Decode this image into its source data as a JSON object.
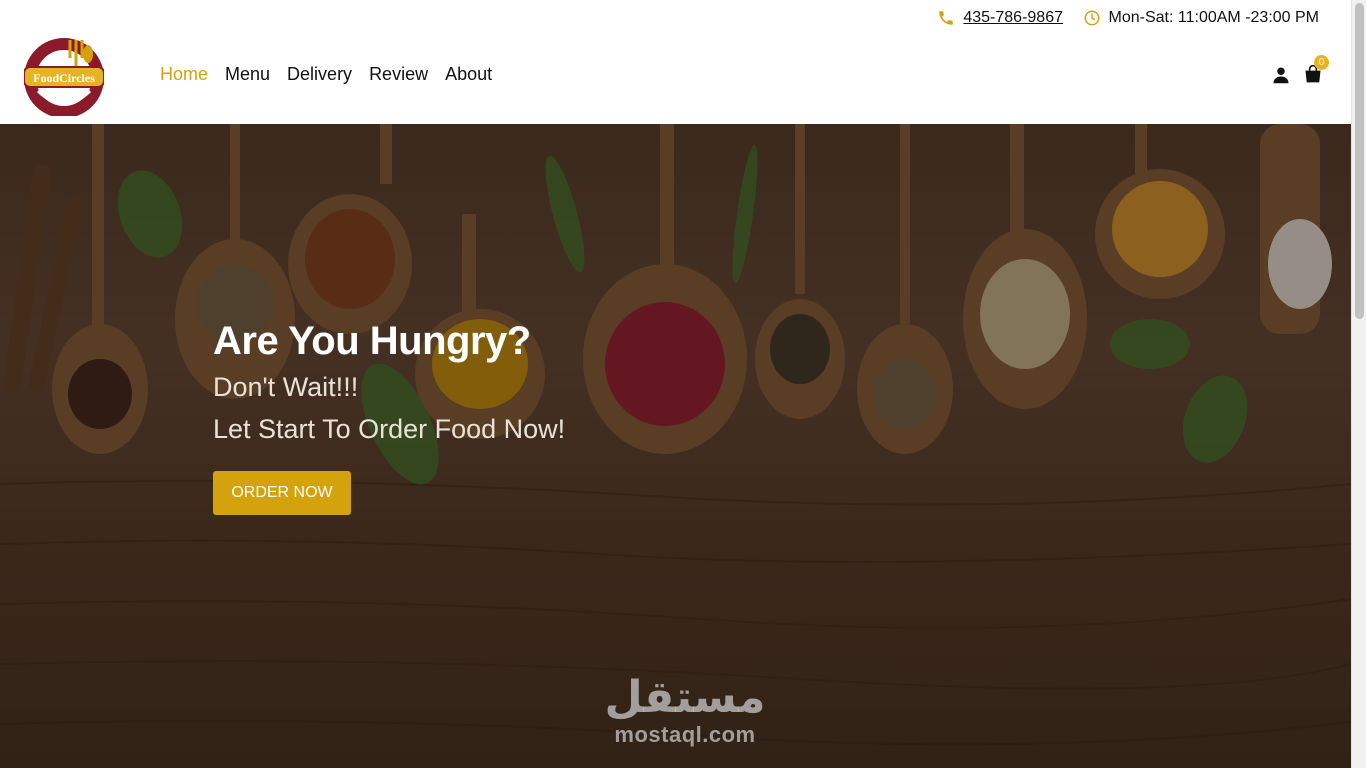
{
  "contact": {
    "phone": "435-786-9867",
    "phone_icon": "phone-icon",
    "hours": "Mon-Sat: 11:00AM -23:00 PM",
    "hours_icon": "clock-icon"
  },
  "brand": {
    "name": "FoodCircles",
    "accent_color": "#d4a20c",
    "logo_ring_color": "#8b1a2b"
  },
  "nav": {
    "items": [
      {
        "label": "Home",
        "active": true
      },
      {
        "label": "Menu"
      },
      {
        "label": "Delivery"
      },
      {
        "label": "Review"
      },
      {
        "label": "About"
      }
    ]
  },
  "header_actions": {
    "user_icon": "user-icon",
    "cart_icon": "shopping-bag-icon",
    "cart_count": "0"
  },
  "hero": {
    "title": "Are You Hungry?",
    "subtitle_1": "Don't Wait!!!",
    "subtitle_2": "Let Start To Order Food Now!",
    "cta_label": "ORDER NOW"
  },
  "watermark": {
    "arabic": "مستقل",
    "latin": "mostaql.com"
  }
}
